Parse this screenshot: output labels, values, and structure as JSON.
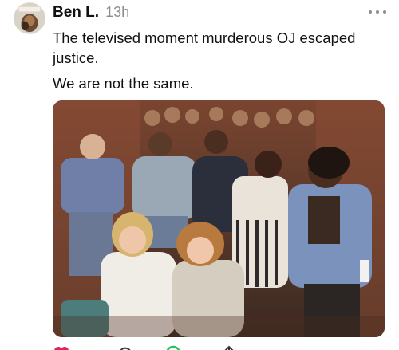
{
  "post": {
    "author": "Ben L.",
    "timestamp": "13h",
    "paragraphs": [
      "The televised moment murderous OJ escaped justice.",
      "We are not the same."
    ]
  },
  "icons": {
    "more": "more-dots-icon",
    "like": "heart-icon",
    "comment": "comment-icon",
    "repost": "repost-icon",
    "share": "share-icon"
  },
  "colors": {
    "text": "#111111",
    "muted": "#8e8e8e",
    "like": "#e0245e",
    "repost": "#22c55e"
  }
}
